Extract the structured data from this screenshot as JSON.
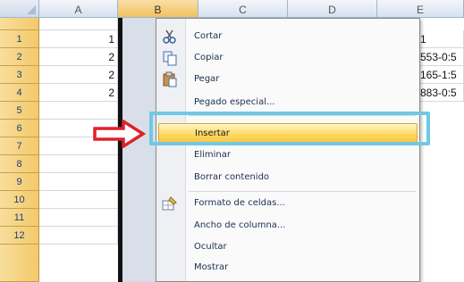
{
  "columns": [
    "A",
    "B",
    "C",
    "D",
    "E"
  ],
  "rows": [
    "1",
    "2",
    "3",
    "4",
    "5",
    "6",
    "7",
    "8",
    "9",
    "10",
    "11",
    "12"
  ],
  "cells": {
    "A": [
      "1",
      "2",
      "2",
      "2"
    ],
    "E": [
      "1",
      "553-0:5",
      "165-1:5",
      "883-0:5"
    ]
  },
  "context_menu": {
    "items": [
      {
        "label": "Cortar",
        "icon": "scissors-icon"
      },
      {
        "label": "Copiar",
        "icon": "copy-icon"
      },
      {
        "label": "Pegar",
        "icon": "paste-icon"
      },
      {
        "label": "Pegado especial...",
        "icon": ""
      },
      {
        "label": "Insertar",
        "icon": "",
        "highlighted": true
      },
      {
        "label": "Eliminar",
        "icon": ""
      },
      {
        "label": "Borrar contenido",
        "icon": ""
      },
      {
        "label": "Formato de celdas...",
        "icon": "format-cells-icon"
      },
      {
        "label": "Ancho de columna...",
        "icon": ""
      },
      {
        "label": "Ocultar",
        "icon": ""
      },
      {
        "label": "Mostrar",
        "icon": ""
      }
    ]
  },
  "colors": {
    "highlight_box": "#6fc9e4",
    "arrow": "#e0212b",
    "menu_highlight": "#ffd660",
    "row_header": "#f3c96a"
  }
}
